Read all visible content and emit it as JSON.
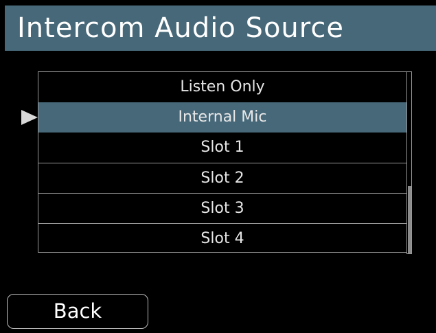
{
  "header": {
    "title": "Intercom Audio Source"
  },
  "list": {
    "items": [
      {
        "label": "Listen Only",
        "selected": false
      },
      {
        "label": "Internal Mic",
        "selected": true
      },
      {
        "label": "Slot 1",
        "selected": false
      },
      {
        "label": "Slot 2",
        "selected": false
      },
      {
        "label": "Slot 3",
        "selected": false
      },
      {
        "label": "Slot 4",
        "selected": false
      }
    ],
    "scroll": {
      "thumb_start_fraction": 0.63,
      "thumb_end_fraction": 1.0
    }
  },
  "footer": {
    "back_label": "Back"
  },
  "icons": {
    "pointer": "selection-pointer-icon"
  },
  "colors": {
    "accent": "#476879",
    "background": "#000000",
    "text": "#ffffff",
    "border": "#9a9a9a"
  }
}
